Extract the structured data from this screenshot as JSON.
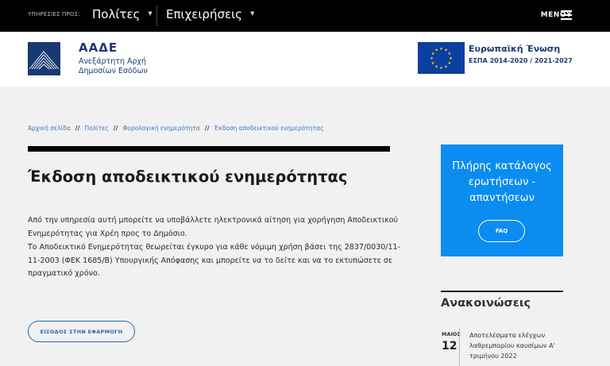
{
  "topbar": {
    "services_label": "ΥΠΗΡΕΣΙΕΣ ΠΡΟΣ:",
    "nav": [
      {
        "label": "Πολίτες",
        "icon": "chevron-down-icon"
      },
      {
        "label": "Επιχειρήσεις",
        "icon": "chevron-down-icon"
      }
    ],
    "menu_label": "ΜΕΝΟΥ",
    "menu_icon": "hamburger-icon",
    "background": "#000000"
  },
  "header": {
    "org_name": "ΑΑΔΕ",
    "org_sub_line1": "Ανεξάρτητη Αρχή",
    "org_sub_line2": "Δημοσίων Εσόδων",
    "eu_title": "Ευρωπαϊκή Ένωση",
    "eu_subtitle": "ΕΣΠΑ 2014-2020 / 2021-2027",
    "brand_color": "#183a72"
  },
  "breadcrumb": [
    "Αρχική σελίδα",
    "Πολίτες",
    "Φορολογική ενημερότητα",
    "Έκδοση αποδεικτικού ενημερότητας"
  ],
  "main": {
    "title": "Έκδοση αποδεικτικού ενημερότητας",
    "paragraph1": "Από την υπηρεσία αυτή μπορείτε να υποβάλλετε ηλεκτρονικά αίτηση για χορήγηση  Αποδεικτικού Ενημερότητας για Χρέη προς το Δημόσιο.",
    "paragraph2": "Το Αποδεικτικό Ενημερότητας θεωρείται έγκυρο για κάθε νόμιμη χρήση βάσει της 2837/0030/11-11-2003 (ΦΕΚ 1685/Β) Υπουργικής Απόφασης και μπορείτε να το δείτε και να το εκτυπώσετε σε πραγματικό χρόνο.",
    "app_button": "ΕΙΣΟΔΟΣ ΣΤΗΝ ΕΦΑΡΜΟΓΗ"
  },
  "sidebar": {
    "faq_text": "Πλήρης κατάλογος ερωτήσεων - απαντήσεων",
    "faq_button": "FAQ",
    "faq_color": "#0b8cf0",
    "announcements_title": "Ανακοινώσεις",
    "announcement": {
      "month": "ΜΑΙΟΣ",
      "day": "12",
      "text": "Αποτελέσματα ελέγχων λαθρεμπορίου καυσίμων Α' τριμήνου 2022"
    }
  }
}
